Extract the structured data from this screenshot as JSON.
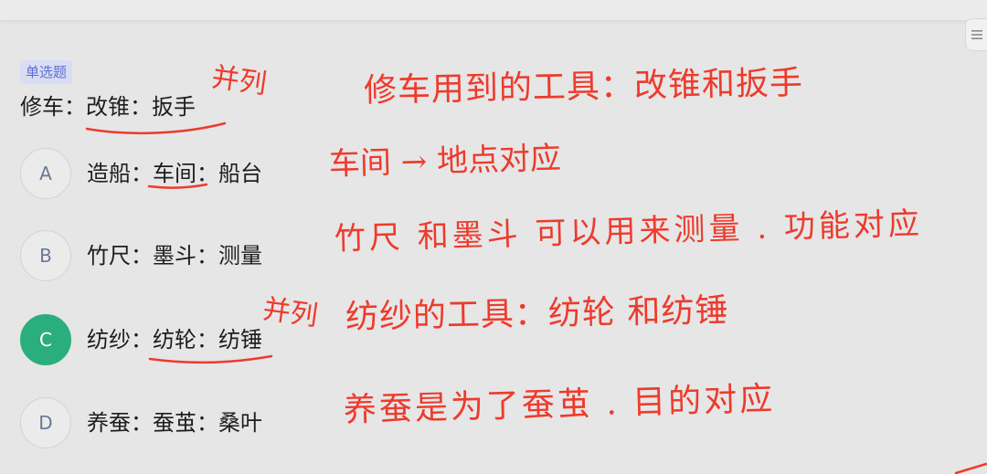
{
  "question": {
    "type_tag": "单选题",
    "stem": "修车：改锥：扳手"
  },
  "options": [
    {
      "letter": "A",
      "text": "造船：车间：船台",
      "selected": false
    },
    {
      "letter": "B",
      "text": "竹尺：墨斗：测量",
      "selected": false
    },
    {
      "letter": "C",
      "text": "纺纱：纺轮：纺锤",
      "selected": true
    },
    {
      "letter": "D",
      "text": "养蚕：蚕茧：桑叶",
      "selected": false
    }
  ],
  "annotations": {
    "stem_relation": "并列",
    "stem_note": "修车用到的工具：改锥和扳手",
    "a_note": "车间 → 地点对应",
    "b_note": "竹尺 和墨斗 可以用来测量 . 功能对应",
    "c_relation": "并列",
    "c_note": "纺纱的工具：纺轮 和纺锤",
    "d_note": "养蚕是为了蚕茧 . 目的对应"
  },
  "colors": {
    "accent": "#2bae7e",
    "ink": "#ee3a2c",
    "tag_bg": "#d9ddf3",
    "tag_text": "#5b6fd6"
  },
  "icons": {
    "menu": "menu-icon"
  }
}
